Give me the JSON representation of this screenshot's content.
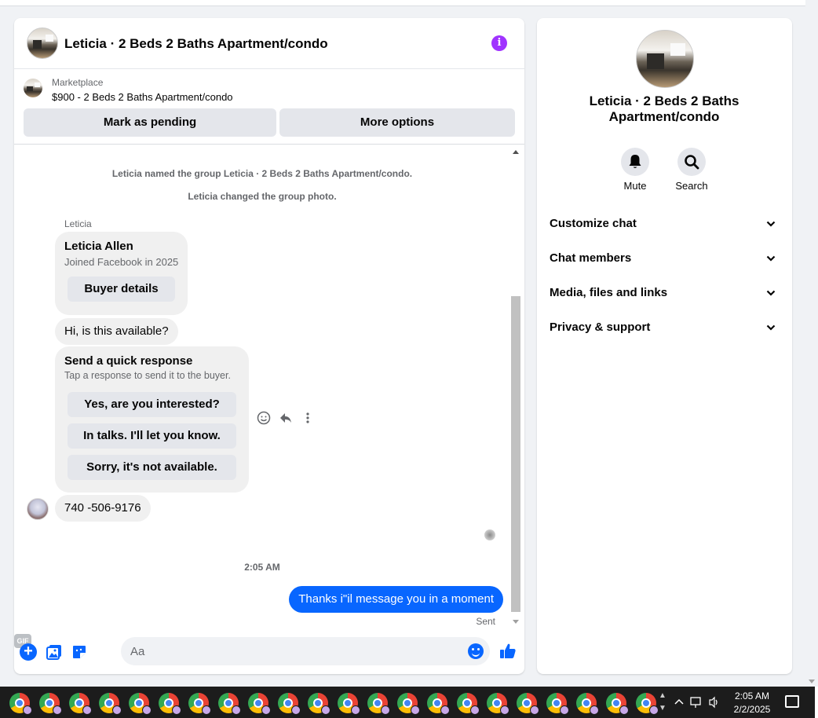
{
  "conversation": {
    "title": "Leticia · 2 Beds 2 Baths Apartment/condo",
    "info_icon": "info-icon"
  },
  "marketplace": {
    "label": "Marketplace",
    "item": "$900 - 2 Beds 2 Baths Apartment/condo",
    "mark_pending": "Mark as pending",
    "more_options": "More options"
  },
  "messages": {
    "system_1": "Leticia named the group Leticia · 2 Beds 2 Baths Apartment/condo.",
    "system_2": "Leticia changed the group photo.",
    "sender": "Leticia",
    "buyer_card": {
      "name": "Leticia Allen",
      "subtitle": "Joined Facebook in 2025",
      "button": "Buyer details"
    },
    "hi": "Hi, is this available?",
    "quick_response": {
      "title": "Send a quick response",
      "subtitle": "Tap a response to send it to the buyer.",
      "options": [
        "Yes, are you interested?",
        "In talks. I'll let you know.",
        "Sorry, it's not available."
      ]
    },
    "phone": "740 -506-9176",
    "timestamp": "2:05 AM",
    "outgoing": "Thanks i\"il message you in a moment",
    "status": "Sent"
  },
  "composer": {
    "placeholder": "Aa",
    "gif_label": "GIF"
  },
  "info_panel": {
    "title": "Leticia · 2 Beds 2 Baths Apartment/condo",
    "actions": [
      "Mute",
      "Search"
    ],
    "sections": [
      "Customize chat",
      "Chat members",
      "Media, files and links",
      "Privacy & support"
    ]
  },
  "taskbar": {
    "time": "2:05 AM",
    "date": "2/2/2025",
    "pinned_app_count": 22
  },
  "colors": {
    "accent": "#0866ff",
    "info": "#a033ff",
    "bubble": "#f0f0f0"
  }
}
